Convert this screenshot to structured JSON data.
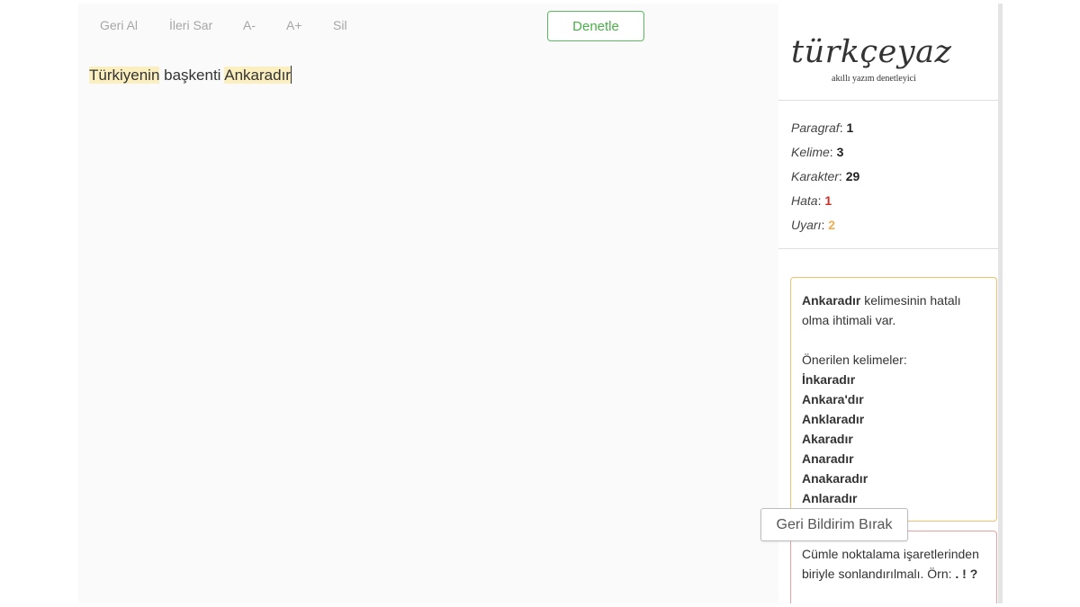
{
  "toolbar": {
    "undo_label": "Geri Al",
    "redo_label": "İleri Sar",
    "font_decrease_label": "A-",
    "font_increase_label": "A+",
    "clear_label": "Sil",
    "check_label": "Denetle"
  },
  "editor": {
    "word1": "Türkiyenin",
    "word2": " başkenti ",
    "word3": "Ankaradır"
  },
  "brand": {
    "title": "türkçeyaz",
    "subtitle": "akıllı yazım denetleyici"
  },
  "stats": {
    "paragraph_label": "Paragraf",
    "paragraph_value": "1",
    "word_label": "Kelime",
    "word_value": "3",
    "char_label": "Karakter",
    "char_value": "29",
    "error_label": "Hata",
    "error_value": "1",
    "warning_label": "Uyarı",
    "warning_value": "2"
  },
  "warning_card": {
    "word": "Ankaradır",
    "message": " kelimesinin hatalı olma ihtimali var.",
    "suggestions_label": "Önerilen kelimeler:",
    "suggestions": [
      "İnkaradır",
      "Ankara'dır",
      "Anklaradır",
      "Akaradır",
      "Anaradır",
      "Anakaradır",
      "Anlaradır"
    ]
  },
  "error_card": {
    "message": "Cümle noktalama işaretlerinden biriyle sonlandırılmalı. Örn: ",
    "example": ". ! ?"
  },
  "feedback_label": "Geri Bildirim Bırak",
  "colors": {
    "highlight": "#fbefbf",
    "check_button": "#5cb85c",
    "error": "#c9302c",
    "warning": "#f0ad4e"
  }
}
